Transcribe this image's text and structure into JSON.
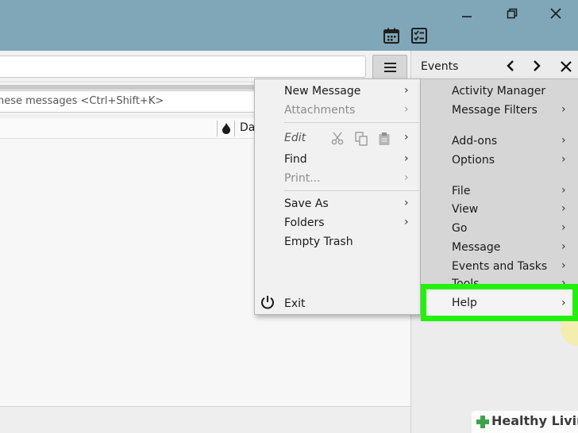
{
  "search": {
    "filter_placeholder": "hese messages <Ctrl+Shift+K>"
  },
  "columns": {
    "date_label": "Da"
  },
  "events_pane": {
    "title": "Events"
  },
  "app_menu": {
    "items": [
      {
        "label": "New Message",
        "has_submenu": true,
        "enabled": true
      },
      {
        "label": "Attachments",
        "has_submenu": true,
        "enabled": false
      },
      {
        "label": "Edit",
        "has_submenu": true,
        "enabled": true
      },
      {
        "label": "Find",
        "has_submenu": true,
        "enabled": true
      },
      {
        "label": "Print...",
        "has_submenu": true,
        "enabled": false
      },
      {
        "label": "Save As",
        "has_submenu": true,
        "enabled": true
      },
      {
        "label": "Folders",
        "has_submenu": true,
        "enabled": true
      },
      {
        "label": "Empty Trash",
        "has_submenu": false,
        "enabled": true
      }
    ],
    "exit_label": "Exit"
  },
  "tools_menu": {
    "items": [
      {
        "label": "Activity Manager",
        "has_submenu": false
      },
      {
        "label": "Message Filters",
        "has_submenu": true
      },
      {
        "label": "Add-ons",
        "has_submenu": true
      },
      {
        "label": "Options",
        "has_submenu": true
      },
      {
        "label": "File",
        "has_submenu": true
      },
      {
        "label": "View",
        "has_submenu": true
      },
      {
        "label": "Go",
        "has_submenu": true
      },
      {
        "label": "Message",
        "has_submenu": true
      },
      {
        "label": "Events and Tasks",
        "has_submenu": true
      },
      {
        "label": "Tools",
        "has_submenu": true
      },
      {
        "label": "Help",
        "has_submenu": true
      }
    ]
  },
  "highlight": {
    "target": "Help",
    "color": "#22f20b"
  },
  "watermark": {
    "text": "Healthy Living"
  },
  "colors": {
    "titlebar": "#7fa7b7",
    "highlight": "#22f20b"
  }
}
